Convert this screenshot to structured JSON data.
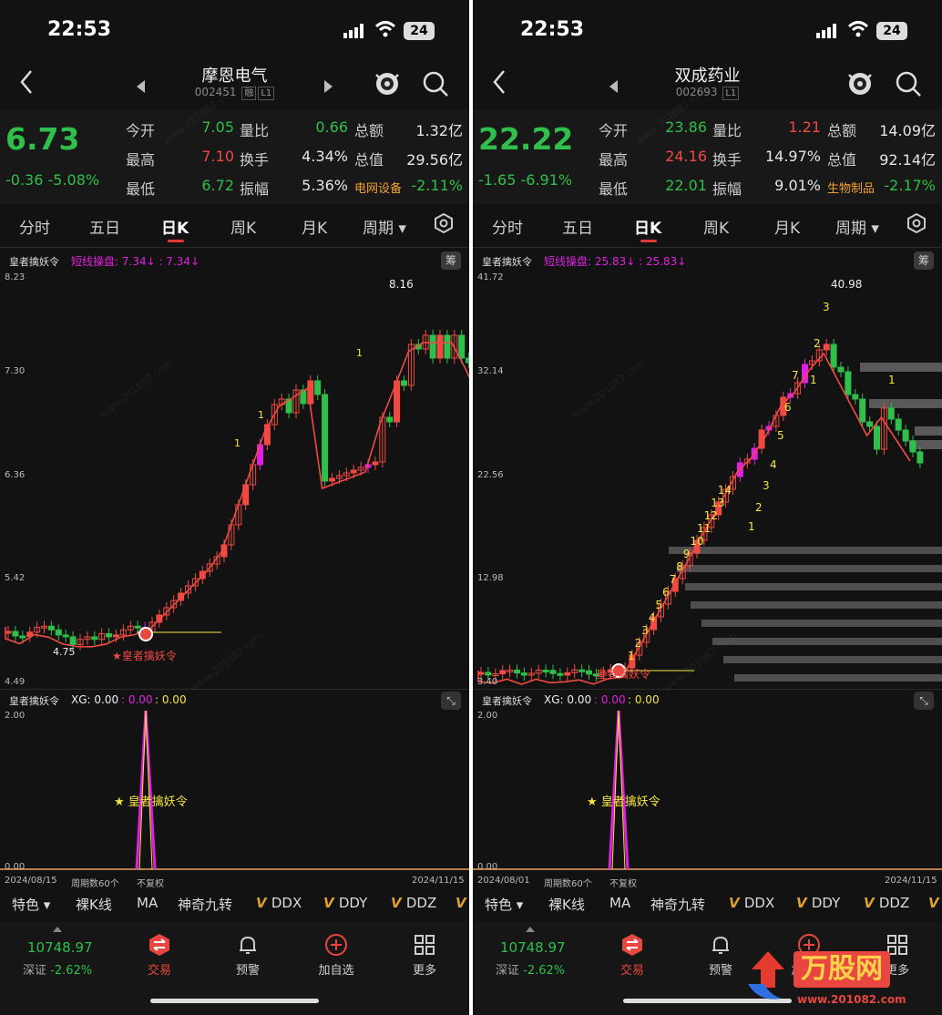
{
  "status": {
    "time": "22:53",
    "battery": "24"
  },
  "left": {
    "title": "摩恩电气",
    "code": "002451",
    "tag1": "融",
    "tag2": "L1",
    "price": "6.73",
    "change": "-0.36",
    "change_pct": "-5.08%",
    "quote": [
      {
        "label": "今开",
        "value": "7.05",
        "label2": "量比",
        "value2": "0.66",
        "label3": "总额",
        "value3": "1.32亿"
      },
      {
        "label": "最高",
        "value": "7.10",
        "label2": "换手",
        "value2": "4.34%",
        "label3": "总值",
        "value3": "29.56亿"
      },
      {
        "label": "最低",
        "value": "6.72",
        "label2": "振幅",
        "value2": "5.36%",
        "label3": "电网设备",
        "value3": "-2.11%"
      }
    ],
    "indicator_name": "皇者擒妖令",
    "indicator_line": "短线操盘: 7.34↓ : 7.34↓",
    "y_ticks": [
      "8.23",
      "7.30",
      "6.36",
      "5.42",
      "4.49"
    ],
    "peak_label": "8.16",
    "low_label": "4.75",
    "signal_label": "★皇者擒妖令",
    "sub_indicator": "皇者擒妖令",
    "xg_line": "XG: 0.00",
    "xg_vals": [
      ": 0.00",
      ": 0.00"
    ],
    "sub_y_top": "2.00",
    "sub_y_bottom": "0.00",
    "date_start": "2024/08/15",
    "date_end": "2024/11/15",
    "period_text": "周期数60个",
    "fq_text": "不复权",
    "sub_signal": "★ 皇者擒妖令",
    "count_labels": [
      "1",
      "1",
      "1"
    ],
    "chart_data": {
      "type": "candlestick",
      "ylim": [
        4.49,
        8.23
      ],
      "high": 8.16,
      "low": 4.75,
      "last": 6.73
    }
  },
  "right": {
    "title": "双成药业",
    "code": "002693",
    "tag2": "L1",
    "price": "22.22",
    "change": "-1.65",
    "change_pct": "-6.91%",
    "quote": [
      {
        "label": "今开",
        "value": "23.86",
        "label2": "量比",
        "value2": "1.21",
        "label3": "总额",
        "value3": "14.09亿"
      },
      {
        "label": "最高",
        "value": "24.16",
        "label2": "换手",
        "value2": "14.97%",
        "label3": "总值",
        "value3": "92.14亿"
      },
      {
        "label": "最低",
        "value": "22.01",
        "label2": "振幅",
        "value2": "9.01%",
        "label3": "生物制品",
        "value3": "-2.17%"
      }
    ],
    "indicator_name": "皇者擒妖令",
    "indicator_line": "短线操盘: 25.83↓ : 25.83↓",
    "y_ticks": [
      "41.72",
      "32.14",
      "22.56",
      "12.98",
      "3.40"
    ],
    "peak_label": "40.98",
    "signal_label": "皇者擒妖令",
    "sub_indicator": "皇者擒妖令",
    "xg_line": "XG: 0.00",
    "xg_vals": [
      ": 0.00",
      ": 0.00"
    ],
    "sub_y_top": "2.00",
    "sub_y_bottom": "0.00",
    "date_start": "2024/08/01",
    "date_end": "2024/11/15",
    "period_text": "周期数60个",
    "fq_text": "不复权",
    "sub_signal": "★ 皇者擒妖令",
    "nine_labels": [
      "1",
      "2",
      "3",
      "4",
      "5",
      "6",
      "7",
      "8",
      "9",
      "10",
      "11",
      "12",
      "13",
      "14"
    ],
    "top_labels": [
      "1",
      "2",
      "3",
      "4",
      "5",
      "6",
      "7",
      "1",
      "2",
      "3",
      "1"
    ],
    "chart_data": {
      "type": "candlestick",
      "ylim": [
        3.4,
        41.72
      ],
      "high": 40.98,
      "last": 22.22
    }
  },
  "tabs": [
    "分时",
    "五日",
    "日K",
    "周K",
    "月K",
    "周期"
  ],
  "chip": "筹",
  "menu": [
    "特色",
    "裸K线",
    "MA",
    "神奇九转",
    "DDX",
    "DDY",
    "DDZ"
  ],
  "bottom": {
    "index_value": "10748.97",
    "index_name": "深证",
    "index_pct": "-2.62%",
    "nav": [
      "交易",
      "预警",
      "加自选",
      "更多"
    ]
  },
  "watermark": "www.201082.com",
  "logo": {
    "brand": "万股网",
    "url": "www.201082.com"
  },
  "colors": {
    "up": "#f04a43",
    "down": "#2fbf4a",
    "magenta": "#e020e0",
    "yellow": "#f5e642",
    "bg": "#121212"
  }
}
